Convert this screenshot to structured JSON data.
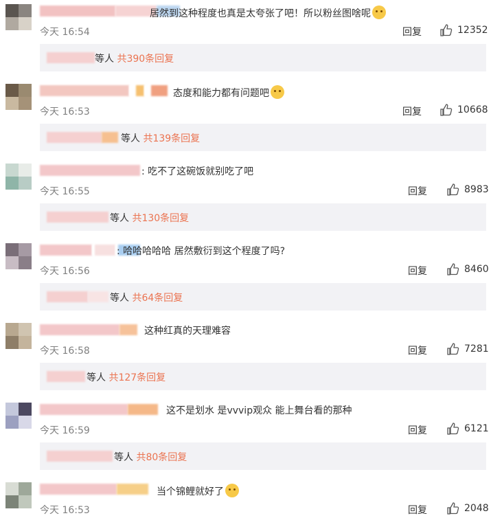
{
  "ui": {
    "reply_label": "回复",
    "time_prefix": "今天",
    "others_label": "等人"
  },
  "colors": {
    "link": "#eb7350",
    "reply_box_bg": "#f2f2f5",
    "muted": "#808080"
  },
  "comments": [
    {
      "text": "居然到这种程度也真是太夸张了吧！所以粉丝图啥呢",
      "emoji": "face-emoji",
      "time": "16:54",
      "likes": "12352",
      "reply_count": "共390条回复"
    },
    {
      "text": "态度和能力都有问题吧",
      "emoji": "smirk-emoji",
      "time": "16:53",
      "likes": "10668",
      "reply_count": "共139条回复"
    },
    {
      "text": ": 吃不了这碗饭就别吃了吧",
      "emoji": "",
      "time": "16:55",
      "likes": "8983",
      "reply_count": "共130条回复"
    },
    {
      "text": ": 哈哈哈哈哈  居然敷衍到这个程度了吗?",
      "emoji": "",
      "time": "16:56",
      "likes": "8460",
      "reply_count": "共64条回复"
    },
    {
      "text": "这种红真的天理难容",
      "emoji": "",
      "time": "16:58",
      "likes": "7281",
      "reply_count": "共127条回复"
    },
    {
      "text": "这不是划水 是vvvip观众 能上舞台看的那种",
      "emoji": "",
      "time": "16:59",
      "likes": "6121",
      "reply_count": "共80条回复"
    },
    {
      "text": "当个锦鲤就好了",
      "emoji": "koi-emoji",
      "time": "16:53",
      "likes": "2048",
      "reply_count": ""
    }
  ]
}
